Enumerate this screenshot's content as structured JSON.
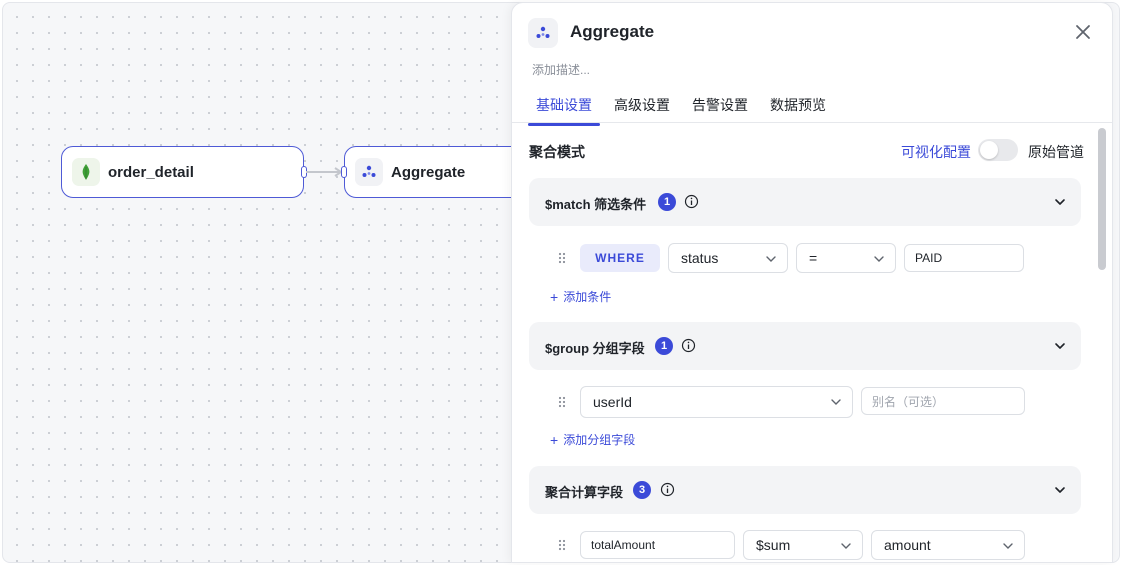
{
  "canvas": {
    "nodes": [
      {
        "label": "order_detail",
        "icon": "mongodb-leaf-icon"
      },
      {
        "label": "Aggregate",
        "icon": "aggregate-icon"
      }
    ]
  },
  "panel": {
    "title": "Aggregate",
    "description_placeholder": "添加描述...",
    "tabs": [
      {
        "label": "基础设置",
        "active": true
      },
      {
        "label": "高级设置",
        "active": false
      },
      {
        "label": "告警设置",
        "active": false
      },
      {
        "label": "数据预览",
        "active": false
      }
    ],
    "mode": {
      "title": "聚合模式",
      "visual_label": "可视化配置",
      "pipeline_label": "原始管道",
      "toggle_on": false
    },
    "match": {
      "title": "$match 筛选条件",
      "count": "1",
      "where": "WHERE",
      "field": "status",
      "operator": "=",
      "value": "PAID",
      "add_label": "添加条件"
    },
    "group": {
      "title": "$group 分组字段",
      "count": "1",
      "field": "userId",
      "alias_placeholder": "别名（可选）",
      "add_label": "添加分组字段"
    },
    "compute": {
      "title": "聚合计算字段",
      "count": "3",
      "name": "totalAmount",
      "func": "$sum",
      "field": "amount"
    }
  },
  "colors": {
    "accent": "#3b4ad8",
    "node_border": "#4e5ad6",
    "mongodb_green": "#3fa037"
  }
}
